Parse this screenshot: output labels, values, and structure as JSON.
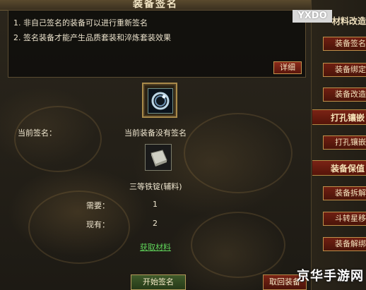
{
  "window": {
    "title": "装备签名"
  },
  "description": {
    "lines": [
      "1. 非自己签名的装备可以进行重新签名",
      "2. 签名装备才能产生品质套装和淬炼套装效果"
    ],
    "detail_button": "详细"
  },
  "signature": {
    "label": "当前签名：",
    "value": "当前装备没有签名"
  },
  "material": {
    "name": "三等铁锭(辅料)",
    "required_label": "需要：",
    "required_value": "1",
    "owned_label": "现有：",
    "owned_value": "2",
    "get_link": "获取材料"
  },
  "buttons": {
    "start": "开始签名",
    "cancel": "取回装备"
  },
  "sidebar": {
    "section1": "材料改造",
    "items1": [
      "装备签名",
      "装备绑定",
      "装备改造"
    ],
    "section2": "打孔镶嵌",
    "items2": [
      "打孔镶嵌"
    ],
    "section3": "装备保值",
    "items3": [
      "装备拆解",
      "斗转星移",
      "装备解绑"
    ]
  },
  "watermarks": {
    "top": "YXDO",
    "bottom": "京华手游网"
  }
}
